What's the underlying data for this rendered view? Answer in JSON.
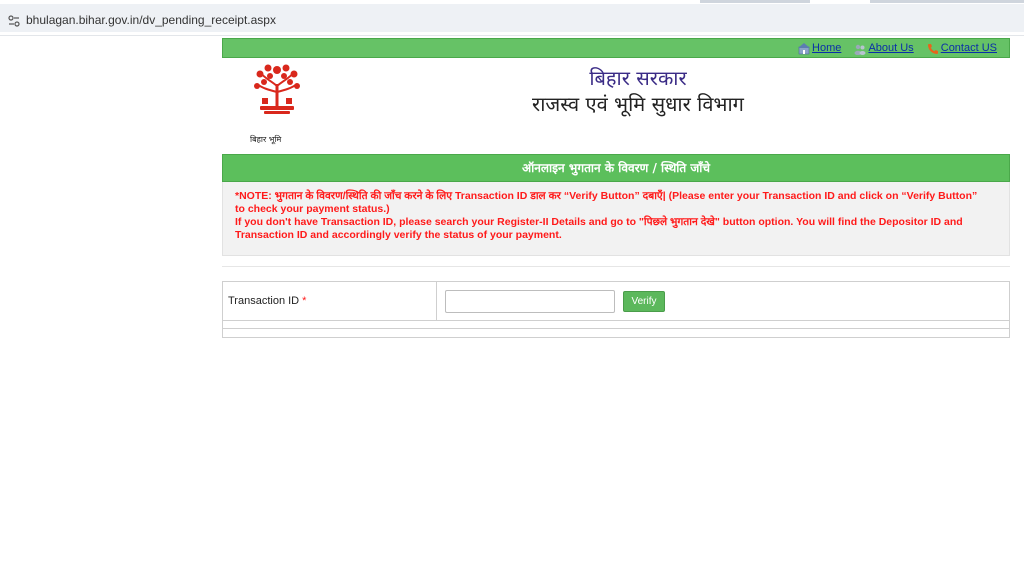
{
  "browser": {
    "url": "bhulagan.bihar.gov.in/dv_pending_receipt.aspx"
  },
  "topnav": {
    "home_label": "Home",
    "about_label": "About Us",
    "contact_label": "Contact US"
  },
  "header": {
    "title_line1": "बिहार सरकार",
    "title_line2": "राजस्व एवं भूमि सुधार विभाग",
    "logo_caption": "बिहार भूमि"
  },
  "section": {
    "title": "ऑनलाइन भुगतान के विवरण / स्थिति जाँचे"
  },
  "note": {
    "line1": "*NOTE: भुगतान के विवरण/स्थिति की जाँच करने के लिए Transaction ID डाल कर “Verify Button” दबाएँ| (Please enter your Transaction ID and click on “Verify Button”",
    "line2": "to check your payment status.)",
    "line3": "If you don't have Transaction ID, please search your Register-II Details and go to \"पिछले भुगतान देखे\" button option. You will find the Depositor ID and",
    "line4": "Transaction ID and accordingly verify the status of your payment."
  },
  "form": {
    "transaction_label": "Transaction ID",
    "required_mark": "*",
    "transaction_value": "",
    "verify_label": "Verify"
  },
  "colors": {
    "nav_green": "#66c266",
    "band_green": "#5cbf5c",
    "note_red": "#ff1a1a",
    "link_blue": "#0b2fa8"
  }
}
